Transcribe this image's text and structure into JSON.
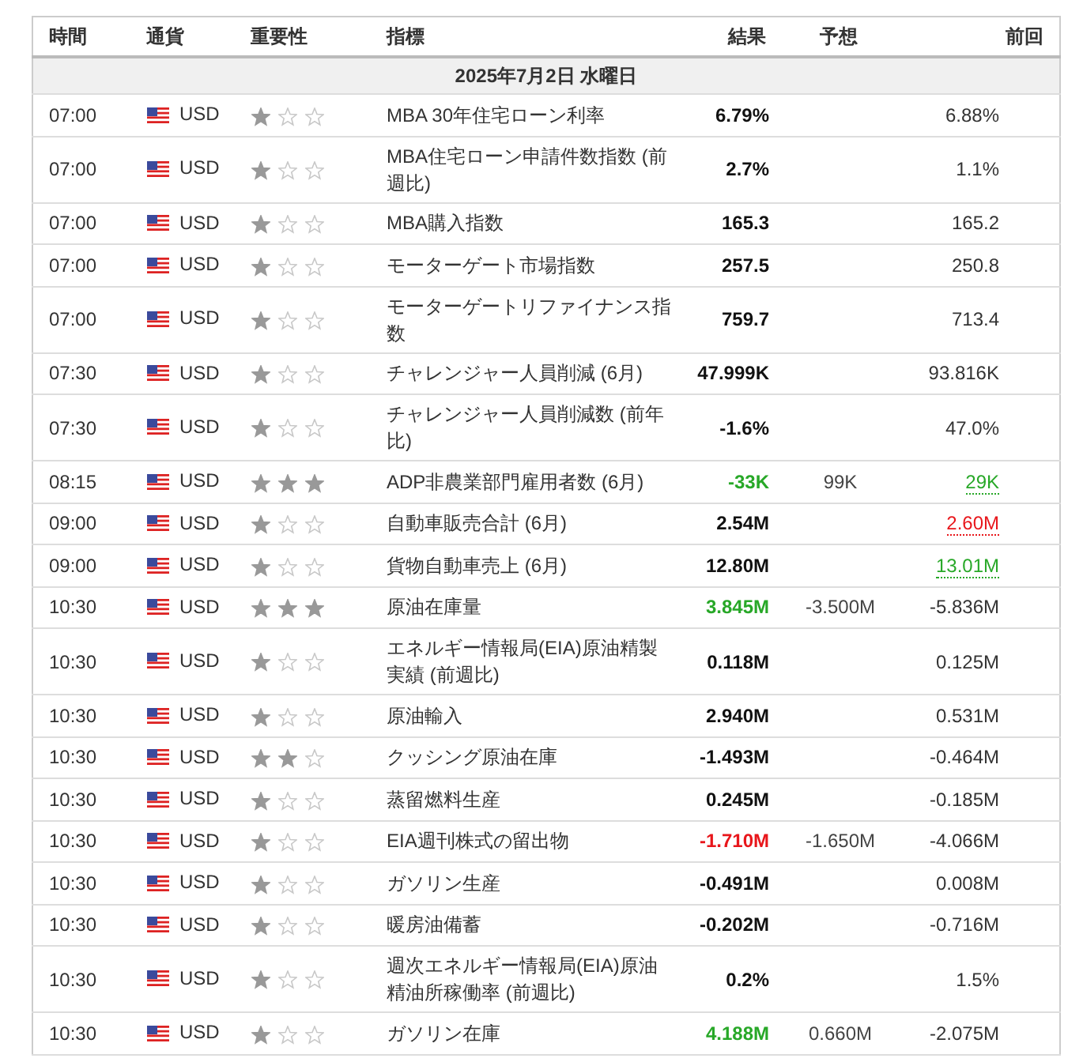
{
  "columns": [
    "時間",
    "通貨",
    "重要性",
    "指標",
    "結果",
    "予想",
    "前回"
  ],
  "date": "2025年7月2日 水曜日",
  "rows": [
    {
      "time": "07:00",
      "currency": "USD",
      "stars": 1,
      "indicator": "MBA 30年住宅ローン利率",
      "actual": "6.79%",
      "actual_better": false,
      "actual_worse": false,
      "forecast": "",
      "previous": "6.88%",
      "previous_revised_up": false,
      "previous_revised_down": false
    },
    {
      "time": "07:00",
      "currency": "USD",
      "stars": 1,
      "indicator": "MBA住宅ローン申請件数指数 (前週比)",
      "actual": "2.7%",
      "actual_better": false,
      "actual_worse": false,
      "forecast": "",
      "previous": "1.1%",
      "previous_revised_up": false,
      "previous_revised_down": false
    },
    {
      "time": "07:00",
      "currency": "USD",
      "stars": 1,
      "indicator": "MBA購入指数",
      "actual": "165.3",
      "actual_better": false,
      "actual_worse": false,
      "forecast": "",
      "previous": "165.2",
      "previous_revised_up": false,
      "previous_revised_down": false
    },
    {
      "time": "07:00",
      "currency": "USD",
      "stars": 1,
      "indicator": "モーターゲート市場指数",
      "actual": "257.5",
      "actual_better": false,
      "actual_worse": false,
      "forecast": "",
      "previous": "250.8",
      "previous_revised_up": false,
      "previous_revised_down": false
    },
    {
      "time": "07:00",
      "currency": "USD",
      "stars": 1,
      "indicator": "モーターゲートリファイナンス指数",
      "actual": "759.7",
      "actual_better": false,
      "actual_worse": false,
      "forecast": "",
      "previous": "713.4",
      "previous_revised_up": false,
      "previous_revised_down": false
    },
    {
      "time": "07:30",
      "currency": "USD",
      "stars": 1,
      "indicator": "チャレンジャー人員削減 (6月)",
      "actual": "47.999K",
      "actual_better": false,
      "actual_worse": false,
      "forecast": "",
      "previous": "93.816K",
      "previous_revised_up": false,
      "previous_revised_down": false
    },
    {
      "time": "07:30",
      "currency": "USD",
      "stars": 1,
      "indicator": "チャレンジャー人員削減数 (前年比)",
      "actual": "-1.6%",
      "actual_better": false,
      "actual_worse": false,
      "forecast": "",
      "previous": "47.0%",
      "previous_revised_up": false,
      "previous_revised_down": false
    },
    {
      "time": "08:15",
      "currency": "USD",
      "stars": 3,
      "indicator": "ADP非農業部門雇用者数 (6月)",
      "actual": "-33K",
      "actual_better": true,
      "actual_worse": false,
      "forecast": "99K",
      "previous": "29K",
      "previous_revised_up": true,
      "previous_revised_down": false
    },
    {
      "time": "09:00",
      "currency": "USD",
      "stars": 1,
      "indicator": "自動車販売合計 (6月)",
      "actual": "2.54M",
      "actual_better": false,
      "actual_worse": false,
      "forecast": "",
      "previous": "2.60M",
      "previous_revised_up": false,
      "previous_revised_down": true
    },
    {
      "time": "09:00",
      "currency": "USD",
      "stars": 1,
      "indicator": "貨物自動車売上 (6月)",
      "actual": "12.80M",
      "actual_better": false,
      "actual_worse": false,
      "forecast": "",
      "previous": "13.01M",
      "previous_revised_up": true,
      "previous_revised_down": false
    },
    {
      "time": "10:30",
      "currency": "USD",
      "stars": 3,
      "indicator": "原油在庫量",
      "actual": "3.845M",
      "actual_better": true,
      "actual_worse": false,
      "forecast": "-3.500M",
      "previous": "-5.836M",
      "previous_revised_up": false,
      "previous_revised_down": false
    },
    {
      "time": "10:30",
      "currency": "USD",
      "stars": 1,
      "indicator": "エネルギー情報局(EIA)原油精製実績 (前週比)",
      "actual": "0.118M",
      "actual_better": false,
      "actual_worse": false,
      "forecast": "",
      "previous": "0.125M",
      "previous_revised_up": false,
      "previous_revised_down": false
    },
    {
      "time": "10:30",
      "currency": "USD",
      "stars": 1,
      "indicator": "原油輸入",
      "actual": "2.940M",
      "actual_better": false,
      "actual_worse": false,
      "forecast": "",
      "previous": "0.531M",
      "previous_revised_up": false,
      "previous_revised_down": false
    },
    {
      "time": "10:30",
      "currency": "USD",
      "stars": 2,
      "indicator": "クッシング原油在庫",
      "actual": "-1.493M",
      "actual_better": false,
      "actual_worse": false,
      "forecast": "",
      "previous": "-0.464M",
      "previous_revised_up": false,
      "previous_revised_down": false
    },
    {
      "time": "10:30",
      "currency": "USD",
      "stars": 1,
      "indicator": "蒸留燃料生産",
      "actual": "0.245M",
      "actual_better": false,
      "actual_worse": false,
      "forecast": "",
      "previous": "-0.185M",
      "previous_revised_up": false,
      "previous_revised_down": false
    },
    {
      "time": "10:30",
      "currency": "USD",
      "stars": 1,
      "indicator": "EIA週刊株式の留出物",
      "actual": "-1.710M",
      "actual_better": false,
      "actual_worse": true,
      "forecast": "-1.650M",
      "previous": "-4.066M",
      "previous_revised_up": false,
      "previous_revised_down": false
    },
    {
      "time": "10:30",
      "currency": "USD",
      "stars": 1,
      "indicator": "ガソリン生産",
      "actual": "-0.491M",
      "actual_better": false,
      "actual_worse": false,
      "forecast": "",
      "previous": "0.008M",
      "previous_revised_up": false,
      "previous_revised_down": false
    },
    {
      "time": "10:30",
      "currency": "USD",
      "stars": 1,
      "indicator": "暖房油備蓄",
      "actual": "-0.202M",
      "actual_better": false,
      "actual_worse": false,
      "forecast": "",
      "previous": "-0.716M",
      "previous_revised_up": false,
      "previous_revised_down": false
    },
    {
      "time": "10:30",
      "currency": "USD",
      "stars": 1,
      "indicator": "週次エネルギー情報局(EIA)原油精油所稼働率 (前週比)",
      "actual": "0.2%",
      "actual_better": false,
      "actual_worse": false,
      "forecast": "",
      "previous": "1.5%",
      "previous_revised_up": false,
      "previous_revised_down": false
    },
    {
      "time": "10:30",
      "currency": "USD",
      "stars": 1,
      "indicator": "ガソリン在庫",
      "actual": "4.188M",
      "actual_better": true,
      "actual_worse": false,
      "forecast": "0.660M",
      "previous": "-2.075M",
      "previous_revised_up": false,
      "previous_revised_down": false
    }
  ]
}
